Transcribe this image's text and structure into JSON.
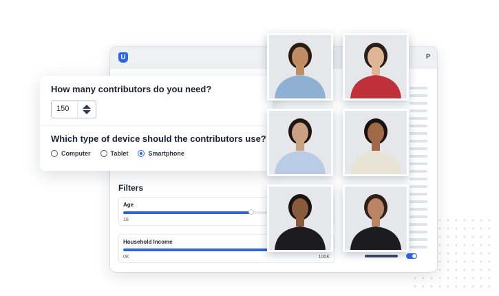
{
  "app": {
    "logo_letter": "U",
    "user_initial": "P"
  },
  "question_card": {
    "contributors_question": "How many contributors do you need?",
    "contributors_value": "150",
    "device_question": "Which type of device should the contributors use?",
    "device_options": [
      "Computer",
      "Tablet",
      "Smartphone"
    ],
    "selected_device": "Smartphone"
  },
  "filters": {
    "title": "Filters",
    "age": {
      "label": "Age",
      "min_value": "18",
      "progress_fraction": 0.62
    },
    "household_income": {
      "label": "Household Income",
      "min_value": "0K",
      "max_value": "100K",
      "progress_fraction": 1.0
    }
  },
  "colors": {
    "accent": "#2f63e6",
    "photo_bg": "#e6e7ea"
  },
  "photos": [
    {
      "name": "contributor-photo-1",
      "skin": "#c08c66",
      "hair": "#2a1c14",
      "top": "#8fb0d2"
    },
    {
      "name": "contributor-photo-2",
      "skin": "#e0b595",
      "hair": "#2b1e18",
      "top": "#c0303a"
    },
    {
      "name": "contributor-photo-3",
      "skin": "#caa183",
      "hair": "#1e1612",
      "top": "#b9cbe6"
    },
    {
      "name": "contributor-photo-4",
      "skin": "#a06a48",
      "hair": "#1b130f",
      "top": "#e9e3d6"
    },
    {
      "name": "contributor-photo-5",
      "skin": "#8a5a3c",
      "hair": "#1a1310",
      "top": "#1c1c1f"
    },
    {
      "name": "contributor-photo-6",
      "skin": "#b98565",
      "hair": "#2e2018",
      "top": "#1c1c1f"
    }
  ]
}
